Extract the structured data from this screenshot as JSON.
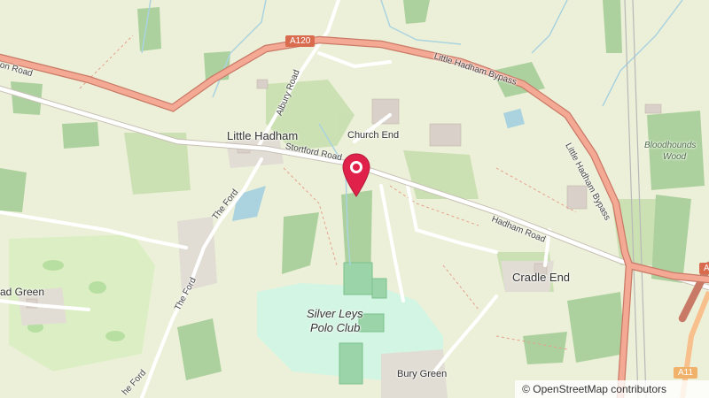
{
  "map": {
    "places": {
      "little_hadham": "Little Hadham",
      "church_end": "Church End",
      "cradle_end": "Cradle End",
      "bury_green": "Bury Green",
      "bloodhounds_wood_line1": "Bloodhounds",
      "bloodhounds_wood_line2": "Wood",
      "polo_line1": "Silver Leys",
      "polo_line2": "Polo Club",
      "green_partial": "ad Green"
    },
    "roads": {
      "a120_shield": "A120",
      "a_shield_right": "A1",
      "a_shield_bottom": "A11",
      "hadham_bypass": "Little Hadham Bypass",
      "hadham_bypass_vertical": "Little Hadham Bypass",
      "albury_road": "Albury Road",
      "stortford_road": "Stortford Road",
      "hadham_road": "Hadham Road",
      "the_ford_1": "The Ford",
      "the_ford_2": "The Ford",
      "the_ford_3": "he Ford",
      "london_road_partial": "on Road"
    },
    "marker": {
      "color": "#e0224a"
    },
    "attribution": "© OpenStreetMap contributors"
  }
}
